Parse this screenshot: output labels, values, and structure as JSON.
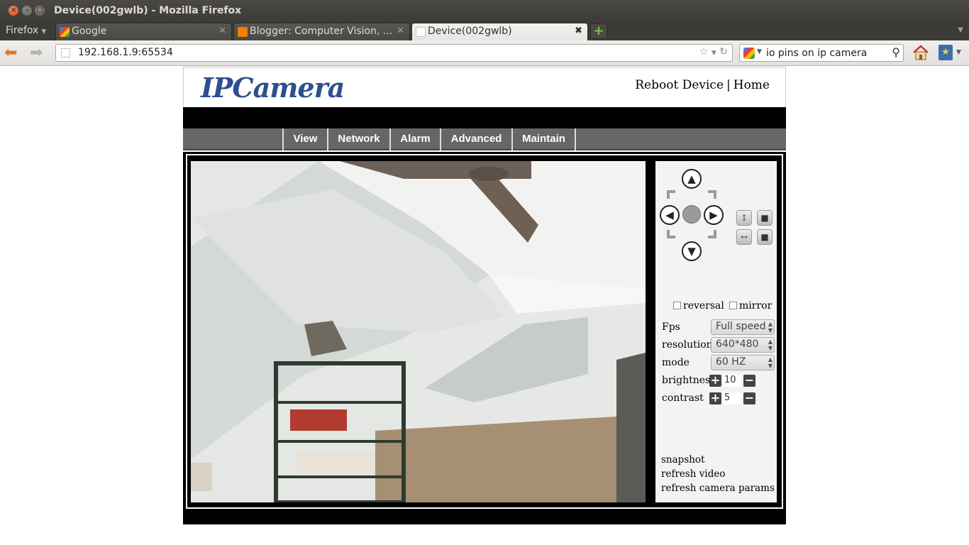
{
  "window": {
    "title": "Device(002gwlb) - Mozilla Firefox"
  },
  "browser": {
    "menu_label": "Firefox",
    "tabs": [
      {
        "label": "Google"
      },
      {
        "label": "Blogger: Computer Vision, ..."
      },
      {
        "label": "Device(002gwlb)"
      }
    ],
    "url": "192.168.1.9:65534",
    "search_query": "io pins on ip camera"
  },
  "page": {
    "logo_text": "IPCamera",
    "top_links": {
      "reboot": "Reboot Device",
      "separator": "|",
      "home": "Home"
    },
    "menu": [
      "View",
      "Network",
      "Alarm",
      "Advanced",
      "Maintain"
    ],
    "controls": {
      "reversal_label": "reversal",
      "mirror_label": "mirror",
      "fps_label": "Fps",
      "fps_value": "Full speed",
      "resolution_label": "resolution",
      "resolution_value": "640*480",
      "mode_label": "mode",
      "mode_value": "60 HZ",
      "brightness_label": "brightness",
      "brightness_value": "10",
      "contrast_label": "contrast",
      "contrast_value": "5"
    },
    "links": {
      "snapshot": "snapshot",
      "refresh_video": "refresh video",
      "refresh_params": "refresh camera params"
    }
  }
}
